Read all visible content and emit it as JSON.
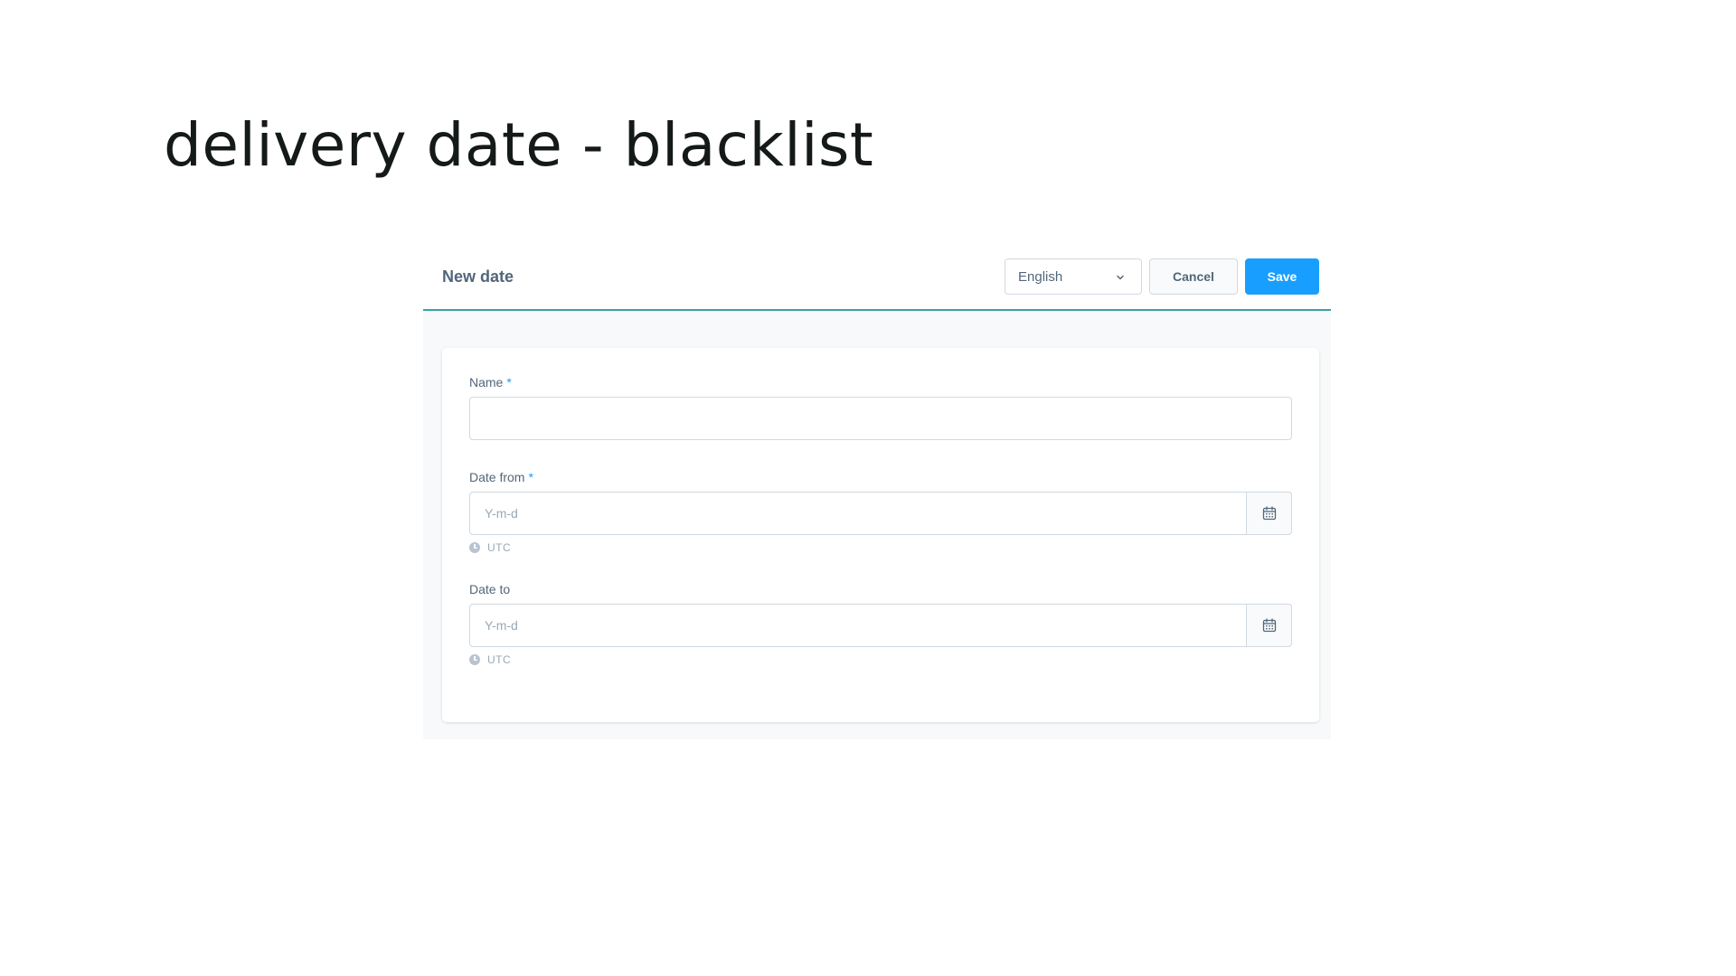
{
  "page": {
    "title": "delivery date - blacklist"
  },
  "header": {
    "title": "New date",
    "language": {
      "selected": "English",
      "icon": "chevron-down-icon"
    },
    "cancel_label": "Cancel",
    "save_label": "Save"
  },
  "form": {
    "name": {
      "label": "Name",
      "required_mark": "*",
      "value": "",
      "placeholder": ""
    },
    "date_from": {
      "label": "Date from",
      "required_mark": "*",
      "value": "",
      "placeholder": "Y-m-d",
      "timezone": "UTC",
      "icon": "calendar-icon"
    },
    "date_to": {
      "label": "Date to",
      "value": "",
      "placeholder": "Y-m-d",
      "timezone": "UTC",
      "icon": "calendar-icon"
    }
  },
  "colors": {
    "accent": "#189eff",
    "header_border": "#3aa2a0",
    "text": "#52667a"
  }
}
